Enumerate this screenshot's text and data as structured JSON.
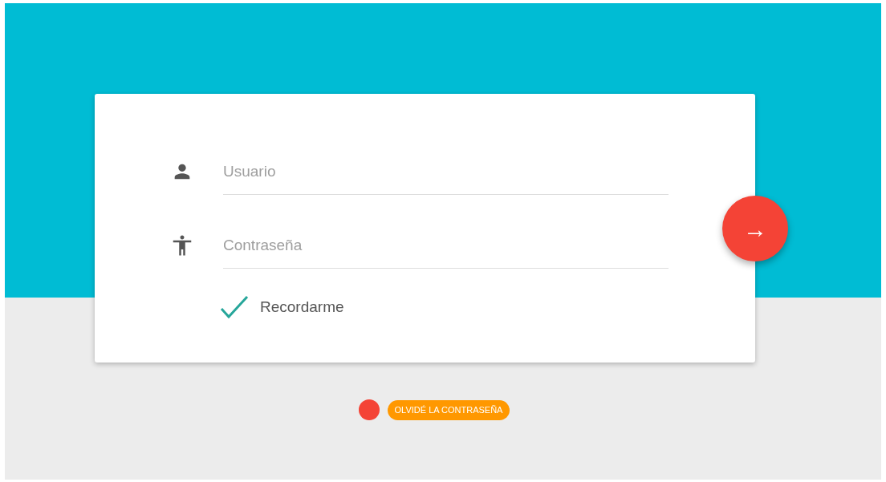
{
  "login_form": {
    "fields": [
      {
        "kind": "user",
        "placeholder": "Usuario"
      },
      {
        "kind": "password",
        "placeholder": "Contraseña"
      }
    ],
    "remember": {
      "label": "Recordarme",
      "checked": true
    },
    "submit_button": {
      "icon": "→"
    }
  },
  "forgot_password_link": "OLVIDÉ LA CONTRASEÑA"
}
